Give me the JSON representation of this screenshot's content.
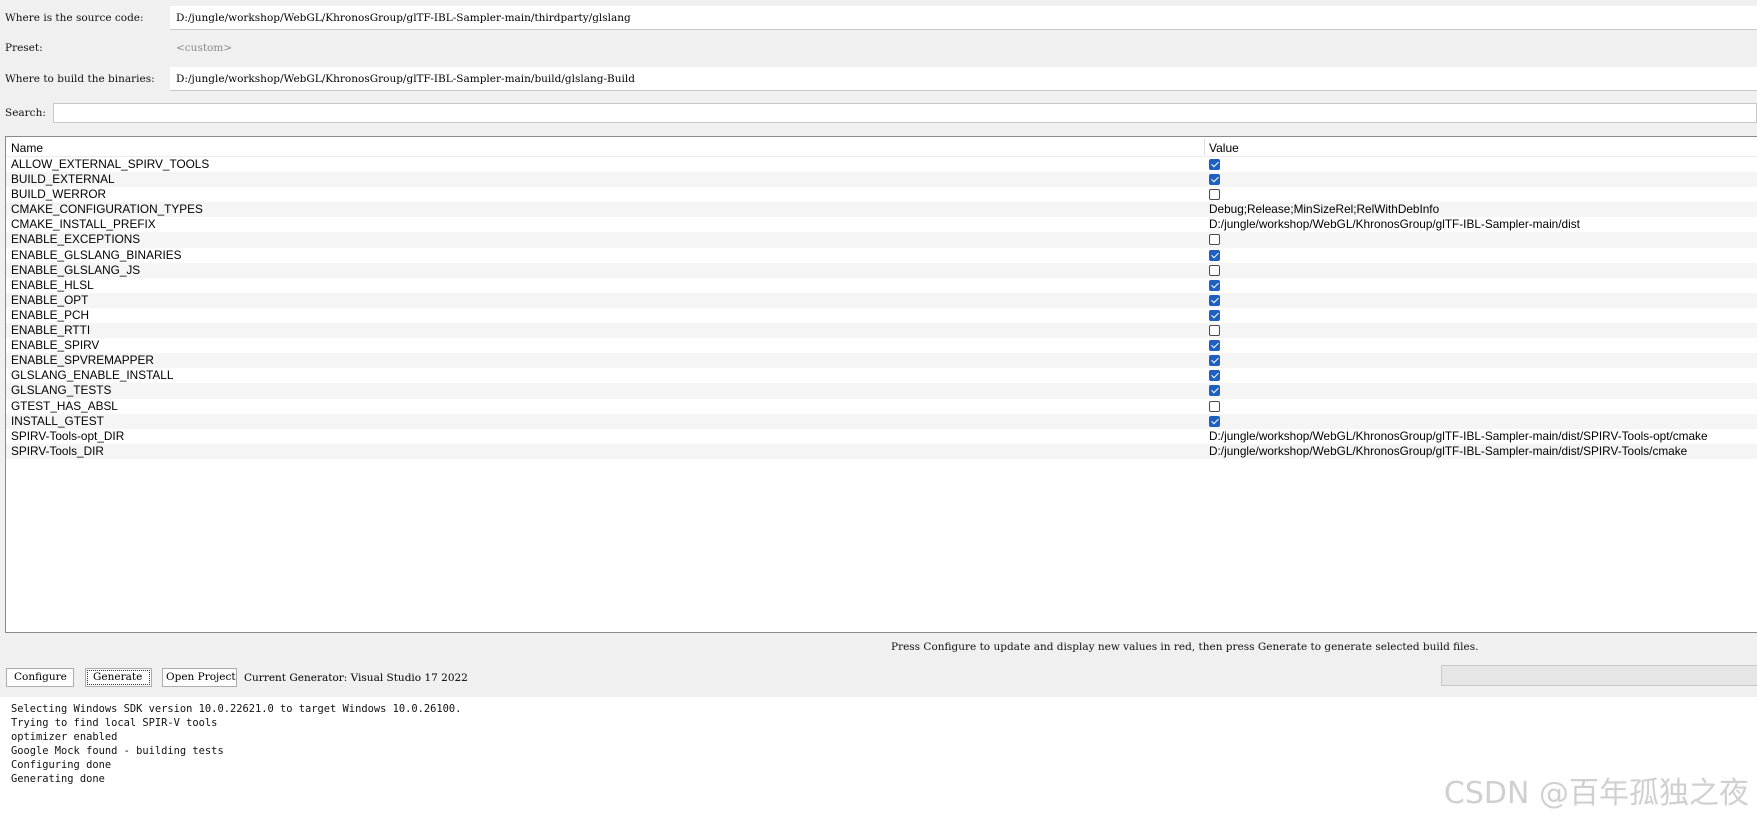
{
  "form": {
    "source_label": "Where is the source code:",
    "source_value": "D:/jungle/workshop/WebGL/KhronosGroup/glTF-IBL-Sampler-main/thirdparty/glslang",
    "preset_label": "Preset:",
    "preset_value": "<custom>",
    "build_label": "Where to build the binaries:",
    "build_value": "D:/jungle/workshop/WebGL/KhronosGroup/glTF-IBL-Sampler-main/build/glslang-Build",
    "search_label": "Search:",
    "search_value": ""
  },
  "table": {
    "col_name": "Name",
    "col_value": "Value",
    "rows": [
      {
        "name": "ALLOW_EXTERNAL_SPIRV_TOOLS",
        "type": "bool",
        "checked": true
      },
      {
        "name": "BUILD_EXTERNAL",
        "type": "bool",
        "checked": true
      },
      {
        "name": "BUILD_WERROR",
        "type": "bool",
        "checked": false
      },
      {
        "name": "CMAKE_CONFIGURATION_TYPES",
        "type": "text",
        "value": "Debug;Release;MinSizeRel;RelWithDebInfo"
      },
      {
        "name": "CMAKE_INSTALL_PREFIX",
        "type": "text",
        "value": "D:/jungle/workshop/WebGL/KhronosGroup/glTF-IBL-Sampler-main/dist"
      },
      {
        "name": "ENABLE_EXCEPTIONS",
        "type": "bool",
        "checked": false
      },
      {
        "name": "ENABLE_GLSLANG_BINARIES",
        "type": "bool",
        "checked": true
      },
      {
        "name": "ENABLE_GLSLANG_JS",
        "type": "bool",
        "checked": false
      },
      {
        "name": "ENABLE_HLSL",
        "type": "bool",
        "checked": true
      },
      {
        "name": "ENABLE_OPT",
        "type": "bool",
        "checked": true
      },
      {
        "name": "ENABLE_PCH",
        "type": "bool",
        "checked": true
      },
      {
        "name": "ENABLE_RTTI",
        "type": "bool",
        "checked": false
      },
      {
        "name": "ENABLE_SPIRV",
        "type": "bool",
        "checked": true
      },
      {
        "name": "ENABLE_SPVREMAPPER",
        "type": "bool",
        "checked": true
      },
      {
        "name": "GLSLANG_ENABLE_INSTALL",
        "type": "bool",
        "checked": true
      },
      {
        "name": "GLSLANG_TESTS",
        "type": "bool",
        "checked": true
      },
      {
        "name": "GTEST_HAS_ABSL",
        "type": "bool",
        "checked": false
      },
      {
        "name": "INSTALL_GTEST",
        "type": "bool",
        "checked": true
      },
      {
        "name": "SPIRV-Tools-opt_DIR",
        "type": "text",
        "value": "D:/jungle/workshop/WebGL/KhronosGroup/glTF-IBL-Sampler-main/dist/SPIRV-Tools-opt/cmake"
      },
      {
        "name": "SPIRV-Tools_DIR",
        "type": "text",
        "value": "D:/jungle/workshop/WebGL/KhronosGroup/glTF-IBL-Sampler-main/dist/SPIRV-Tools/cmake"
      }
    ]
  },
  "hint": "Press Configure to update and display new values in red, then press Generate to generate selected build files.",
  "buttons": {
    "configure": "Configure",
    "generate": "Generate",
    "open_project": "Open Project"
  },
  "generator": "Current Generator: Visual Studio 17 2022",
  "log": [
    "Selecting Windows SDK version 10.0.22621.0 to target Windows 10.0.26100.",
    "Trying to find local SPIR-V tools",
    "optimizer enabled",
    "Google Mock found - building tests",
    "Configuring done",
    "Generating done"
  ],
  "watermark": "CSDN @百年孤独之夜",
  "colors": {
    "checkbox_checked": "#1e5fbf"
  }
}
